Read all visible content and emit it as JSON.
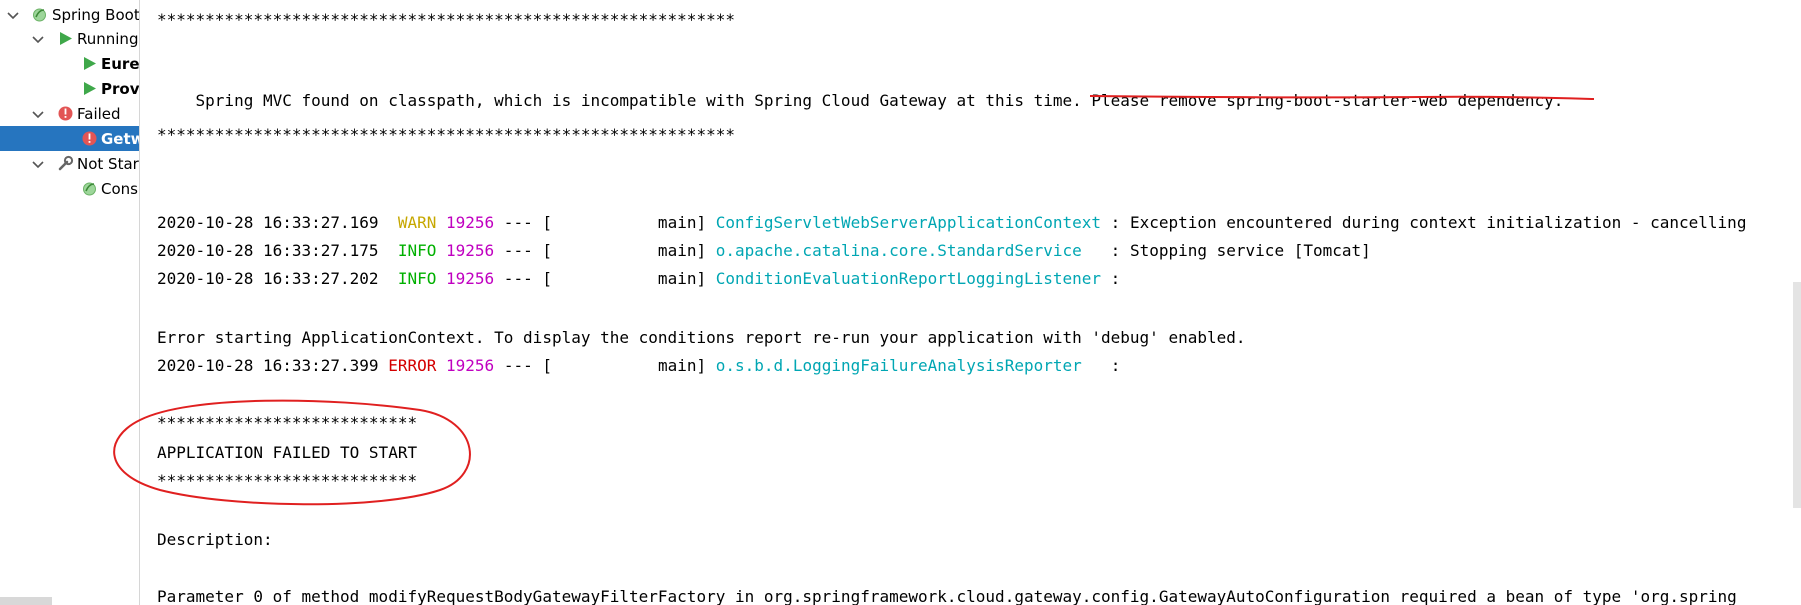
{
  "sidebar": {
    "items": [
      {
        "label": "Spring Boot",
        "icon": "spring-boot-icon"
      },
      {
        "label": "Running",
        "icon": "run-icon"
      },
      {
        "label": "Eurel",
        "icon": "run-icon"
      },
      {
        "label": "Provi",
        "icon": "run-icon"
      },
      {
        "label": "Failed",
        "icon": "error-icon"
      },
      {
        "label": "Getw",
        "icon": "error-icon"
      },
      {
        "label": "Not Star",
        "icon": "wrench-icon"
      },
      {
        "label": "Cons",
        "icon": "spring-boot-icon"
      }
    ]
  },
  "console": {
    "stars_long": "************************************************************",
    "stars_short": "***************************",
    "mvc_message_start": "Spring MVC found on classpath, which is incompatible with Spring Cloud Gateway at this time. ",
    "mvc_message_end": "Please remove spring-boot-starter-web dependency.",
    "logs": [
      {
        "timestamp": "2020-10-28 16:33:27.169",
        "level": "WARN",
        "level_pad": "  ",
        "pid": "19256",
        "sep": " --- [",
        "thread": "           main] ",
        "logger": "ConfigServletWebServerApplicationContext",
        "message": " : Exception encountered during context initialization - cancelling"
      },
      {
        "timestamp": "2020-10-28 16:33:27.175",
        "level": "INFO",
        "level_pad": "  ",
        "pid": "19256",
        "sep": " --- [",
        "thread": "           main] ",
        "logger": "o.apache.catalina.core.StandardService  ",
        "message": " : Stopping service [Tomcat]"
      },
      {
        "timestamp": "2020-10-28 16:33:27.202",
        "level": "INFO",
        "level_pad": "  ",
        "pid": "19256",
        "sep": " --- [",
        "thread": "           main] ",
        "logger": "ConditionEvaluationReportLoggingListener",
        "message": " :"
      },
      {
        "timestamp": "2020-10-28 16:33:27.399",
        "level": "ERROR",
        "level_pad": " ",
        "pid": "19256",
        "sep": " --- [",
        "thread": "           main] ",
        "logger": "o.s.b.d.LoggingFailureAnalysisReporter  ",
        "message": " :"
      }
    ],
    "error_starting": "Error starting ApplicationContext. To display the conditions report re-run your application with 'debug' enabled.",
    "app_failed": "APPLICATION FAILED TO START",
    "description_label": "Description:",
    "parameter_line": "Parameter 0 of method modifyRequestBodyGatewayFilterFactory in org.springframework.cloud.gateway.config.GatewayAutoConfiguration required a bean of type 'org.spring"
  },
  "colors": {
    "warn": "#c6a700",
    "info": "#00b000",
    "error": "#d40000",
    "pid": "#c000c0",
    "logger": "#00a6b3",
    "selection": "#2675bf",
    "annotation": "#e02020"
  }
}
